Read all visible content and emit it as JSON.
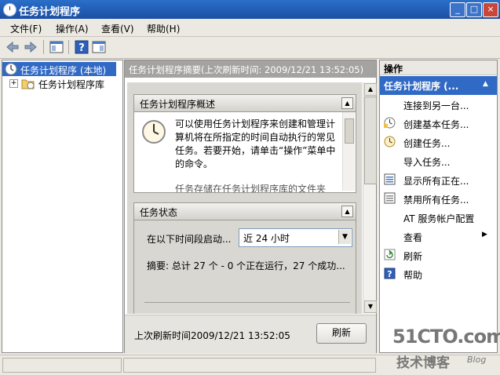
{
  "window": {
    "title": "任务计划程序"
  },
  "menu": [
    "文件(F)",
    "操作(A)",
    "查看(V)",
    "帮助(H)"
  ],
  "tree": {
    "root": "任务计划程序 (本地)",
    "child": "任务计划程序库"
  },
  "center": {
    "header": "任务计划程序摘要(上次刷新时间: 2009/12/21 13:52:05)",
    "overview": {
      "title": "任务计划程序概述",
      "text": "可以使用任务计划程序来创建和管理计算机将在所指定的时间自动执行的常见任务。若要开始，请单击“操作”菜单中的命令。",
      "text2": "任务存储在任务计划程序库的文件夹"
    },
    "status": {
      "title": "任务状态",
      "period_label": "在以下时间段启动...",
      "period_value": "近 24 小时",
      "summary": "摘要: 总计 27 个 - 0 个正在运行，27 个成功..."
    },
    "footer": {
      "last_refresh": "上次刷新时间2009/12/21 13:52:05",
      "refresh_button": "刷新"
    }
  },
  "actions": {
    "header": "操作",
    "section": "任务计划程序 (...",
    "items": [
      {
        "label": "连接到另一台...",
        "icon": ""
      },
      {
        "label": "创建基本任务...",
        "icon": "create-basic-task-icon"
      },
      {
        "label": "创建任务...",
        "icon": "create-task-icon"
      },
      {
        "label": "导入任务...",
        "icon": ""
      },
      {
        "label": "显示所有正在...",
        "icon": "running-tasks-icon"
      },
      {
        "label": "禁用所有任务...",
        "icon": "disable-history-icon"
      },
      {
        "label": "AT 服务帐户配置",
        "icon": ""
      },
      {
        "label": "查看",
        "icon": ""
      },
      {
        "label": "刷新",
        "icon": "refresh-icon"
      },
      {
        "label": "帮助",
        "icon": "help-icon"
      }
    ]
  },
  "watermark": {
    "site": "51CTO.com",
    "sub": "技术博客",
    "blog": "Blog"
  }
}
